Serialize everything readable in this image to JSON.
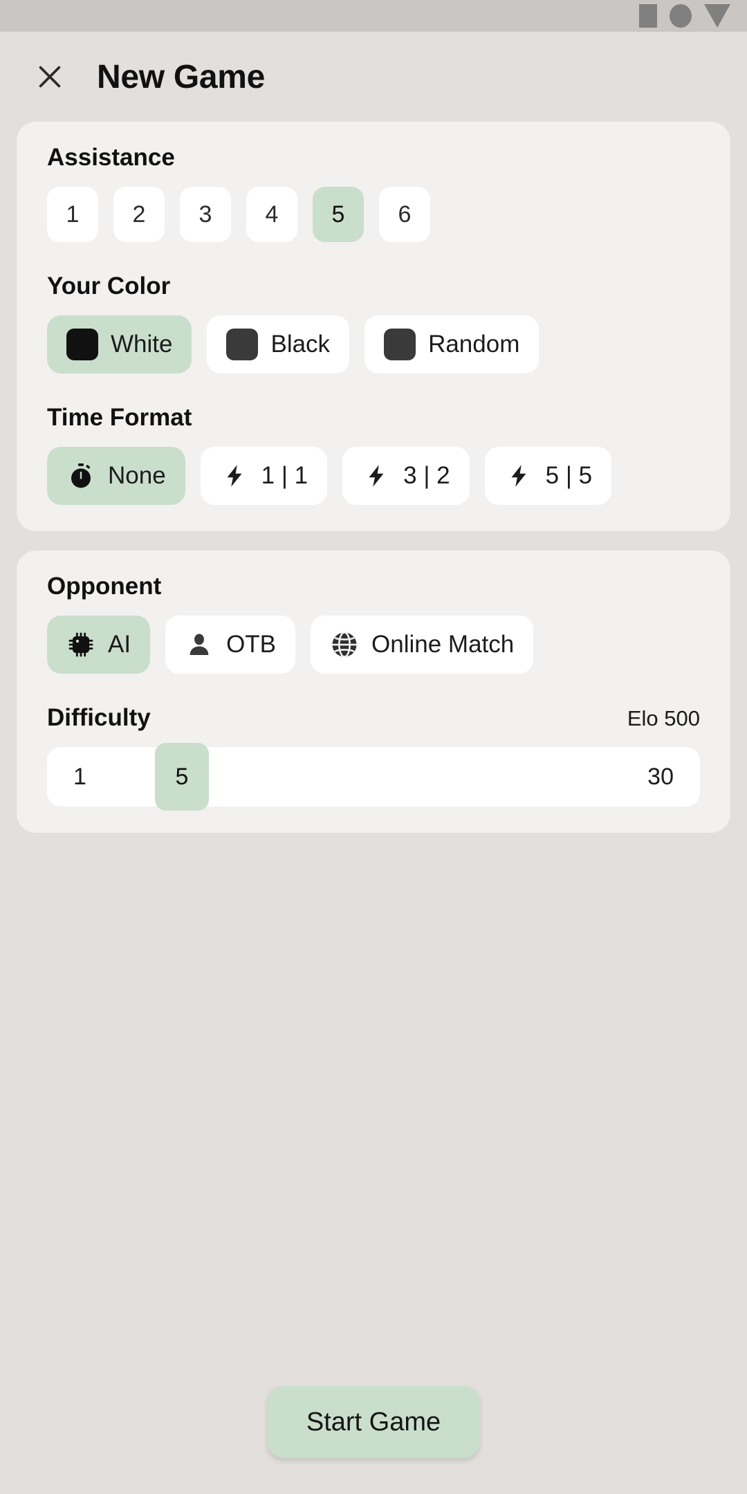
{
  "status_bar": {
    "icons": [
      "square-icon",
      "circle-icon",
      "triangle-down-icon"
    ]
  },
  "header": {
    "close_icon": "close-icon",
    "title": "New Game"
  },
  "colors": {
    "accent_selected": "#cadecc",
    "card_bg": "#f2f1ef",
    "page_bg": "#e2dfdc",
    "chip_bg": "#ffffff",
    "status_bar_bg": "#c9c6c3"
  },
  "settings_card": {
    "assistance": {
      "label": "Assistance",
      "options": [
        {
          "value": "1",
          "selected": false
        },
        {
          "value": "2",
          "selected": false
        },
        {
          "value": "3",
          "selected": false
        },
        {
          "value": "4",
          "selected": false
        },
        {
          "value": "5",
          "selected": true
        },
        {
          "value": "6",
          "selected": false
        }
      ]
    },
    "your_color": {
      "label": "Your Color",
      "options": [
        {
          "label": "White",
          "swatch": "#111111",
          "icon": "white-square-icon",
          "selected": true
        },
        {
          "label": "Black",
          "swatch": "#3a3a3a",
          "icon": "black-square-icon",
          "selected": false
        },
        {
          "label": "Random",
          "swatch": "#3a3a3a",
          "icon": "random-square-icon",
          "selected": false
        }
      ]
    },
    "time_format": {
      "label": "Time Format",
      "options": [
        {
          "label": "None",
          "icon": "stopwatch-icon",
          "selected": true
        },
        {
          "label": "1 | 1",
          "icon": "bolt-icon",
          "selected": false
        },
        {
          "label": "3 | 2",
          "icon": "bolt-icon",
          "selected": false
        },
        {
          "label": "5 | 5",
          "icon": "bolt-icon",
          "selected": false
        }
      ]
    }
  },
  "opponent_card": {
    "opponent": {
      "label": "Opponent",
      "options": [
        {
          "label": "AI",
          "icon": "cpu-chip-icon",
          "selected": true
        },
        {
          "label": "OTB",
          "icon": "person-icon",
          "selected": false
        },
        {
          "label": "Online Match",
          "icon": "globe-icon",
          "selected": false
        }
      ]
    },
    "difficulty": {
      "label": "Difficulty",
      "elo": "Elo 500",
      "min": "1",
      "max": "30",
      "value": "5"
    }
  },
  "footer": {
    "start_label": "Start Game"
  }
}
